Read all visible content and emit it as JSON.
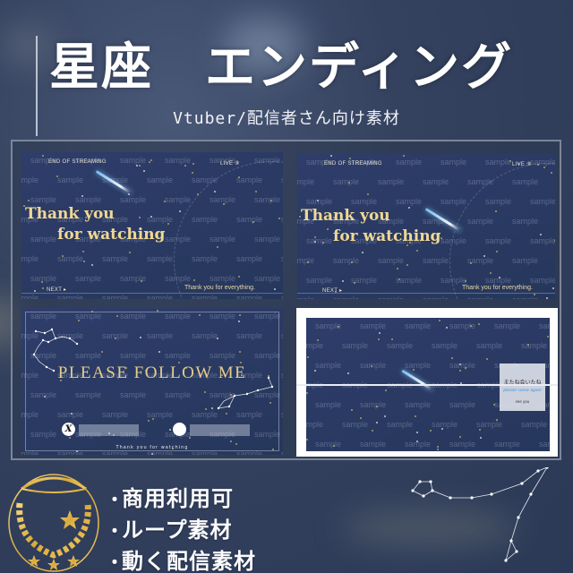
{
  "header": {
    "title": "星座　エンディング",
    "subtitle": "Vtuber/配信者さん向け素材"
  },
  "watermark_text": "sample",
  "previews": [
    {
      "id": "ending-1",
      "top_left_label": "END OF STREAMING",
      "top_right_label": "LIVE ⑨",
      "headline_line1": "Thank you",
      "headline_line2": "for watching",
      "bottom_left_label": "NEXT ▸",
      "bottom_right_label": "Thank you for everything."
    },
    {
      "id": "ending-2",
      "top_left_label": "END OF STREAMING",
      "top_right_label": "LIVE ⑨",
      "headline_line1": "Thank you",
      "headline_line2": "for watching",
      "bottom_left_label": "NEXT ▸",
      "bottom_right_label": "Thank you for everything."
    },
    {
      "id": "follow",
      "headline": "PLEASE FOLLOW ME",
      "sns": [
        {
          "icon": "x-logo-icon",
          "glyph": "X",
          "placeholder": ""
        },
        {
          "icon": "circle-logo-icon",
          "glyph": "",
          "placeholder": ""
        }
      ],
      "footer": "Thank you for watching"
    },
    {
      "id": "wide-loop",
      "card": {
        "line1": "またね会いたね",
        "line2": "please come again",
        "line3": "see you"
      }
    }
  ],
  "features": [
    {
      "bullet": "・",
      "label": "商用利用可"
    },
    {
      "bullet": "・",
      "label": "ループ素材"
    },
    {
      "bullet": "・",
      "label": "動く配信素材"
    }
  ],
  "colors": {
    "background": "#34425f",
    "panel": "#2a3a63",
    "gold": "#e4c572",
    "headline_gold": "#f0d893",
    "frame_border": "#7c8699"
  },
  "icons": {
    "emblem": "moon-star-emblem-icon",
    "constellation": "constellation-icon"
  }
}
